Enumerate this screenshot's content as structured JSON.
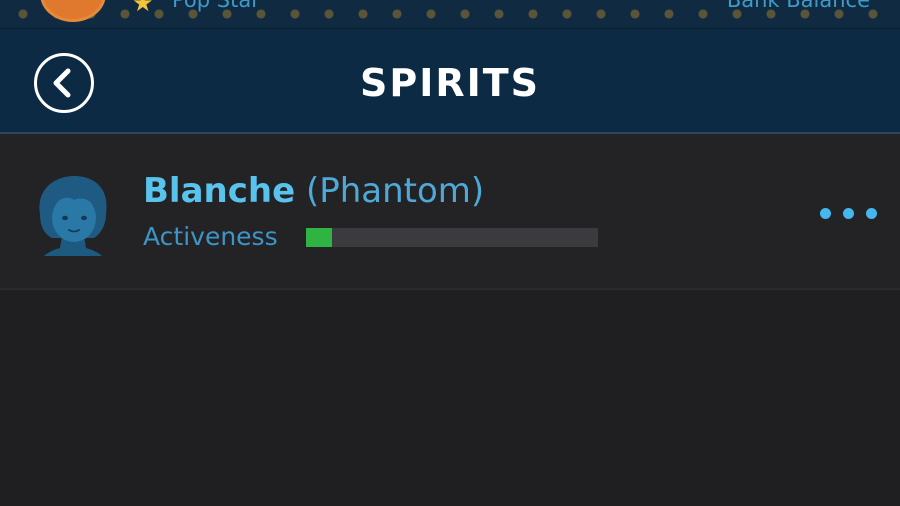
{
  "top_bar": {
    "status_label": "Pop Star",
    "balance_label": "Bank Balance",
    "star_icon": "star-icon"
  },
  "header": {
    "title": "SPIRITS",
    "back_icon": "chevron-left-icon"
  },
  "spirits": [
    {
      "name": "Blanche",
      "type": "(Phantom)",
      "activeness_label": "Activeness",
      "activeness_level": 0.09,
      "avatar_icon": "ghost-avatar-icon",
      "more_icon": "ellipsis-icon"
    }
  ],
  "colors": {
    "header_bg": "#0d2a44",
    "page_bg": "#1f1f21",
    "name_blue": "#58c4ee",
    "activeness_green": "#2fb342",
    "dots_blue": "#45b6ee"
  }
}
